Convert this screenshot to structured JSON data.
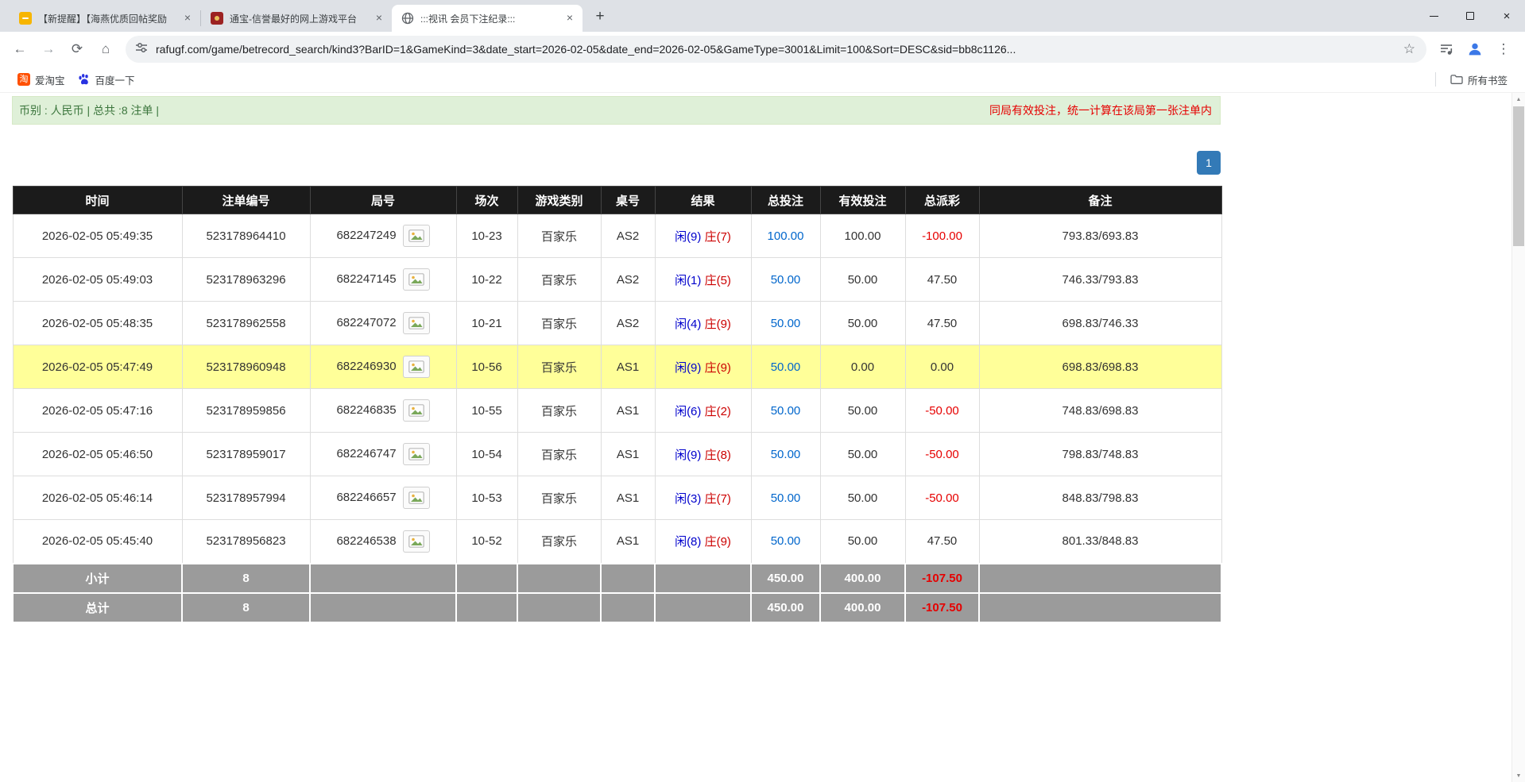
{
  "icons": {
    "tab_close": "×",
    "new_tab": "+",
    "window_close": "×",
    "back": "←",
    "forward": "→",
    "reload": "⟳",
    "home": "⌂",
    "star": "☆",
    "menu": "⋮",
    "scroll_up": "▲",
    "scroll_down": "▼",
    "taobao_glyph": "淘"
  },
  "colors": {
    "accent_blue": "#337ab7",
    "highlight_row": "#ffff99",
    "info_bar_bg": "#dff0d8",
    "info_text_green": "#3c763d",
    "notice_red": "#e60000",
    "link_blue": "#0066cc",
    "player_blue": "#0000cc",
    "banker_red": "#cc0000"
  },
  "browser": {
    "tabs": [
      {
        "title": "【新提醒】【海燕优质回帖奖励",
        "active": false
      },
      {
        "title": "通宝-信誉最好的网上游戏平台",
        "active": false
      },
      {
        "title": ":::视讯 会员下注纪录:::",
        "active": true
      }
    ],
    "url": "rafugf.com/game/betrecord_search/kind3?BarID=1&GameKind=3&date_start=2026-02-05&date_end=2026-02-05&GameType=3001&Limit=100&Sort=DESC&sid=bb8c1126...",
    "bookmarks": [
      {
        "label": "爱淘宝"
      },
      {
        "label": "百度一下"
      }
    ],
    "all_bookmarks_label": "所有书签"
  },
  "page": {
    "info_bar": {
      "summary": "币别 : 人民币 | 总共 :8 注单 |",
      "notice": "同局有效投注，统一计算在该局第一张注单内"
    },
    "pagination": {
      "current": "1"
    },
    "table": {
      "headers": [
        "时间",
        "注单编号",
        "局号",
        "场次",
        "游戏类别",
        "桌号",
        "结果",
        "总投注",
        "有效投注",
        "总派彩",
        "备注"
      ],
      "rows": [
        {
          "time": "2026-02-05 05:49:35",
          "bet_id": "523178964410",
          "round_no": "682247249",
          "session": "10-23",
          "game_type": "百家乐",
          "table_no": "AS2",
          "result_player": "闲(9)",
          "result_banker": "庄(7)",
          "total_bet": "100.00",
          "valid_bet": "100.00",
          "payout": "-100.00",
          "remark": "793.83/693.83",
          "highlight": false
        },
        {
          "time": "2026-02-05 05:49:03",
          "bet_id": "523178963296",
          "round_no": "682247145",
          "session": "10-22",
          "game_type": "百家乐",
          "table_no": "AS2",
          "result_player": "闲(1)",
          "result_banker": "庄(5)",
          "total_bet": "50.00",
          "valid_bet": "50.00",
          "payout": "47.50",
          "remark": "746.33/793.83",
          "highlight": false
        },
        {
          "time": "2026-02-05 05:48:35",
          "bet_id": "523178962558",
          "round_no": "682247072",
          "session": "10-21",
          "game_type": "百家乐",
          "table_no": "AS2",
          "result_player": "闲(4)",
          "result_banker": "庄(9)",
          "total_bet": "50.00",
          "valid_bet": "50.00",
          "payout": "47.50",
          "remark": "698.83/746.33",
          "highlight": false
        },
        {
          "time": "2026-02-05 05:47:49",
          "bet_id": "523178960948",
          "round_no": "682246930",
          "session": "10-56",
          "game_type": "百家乐",
          "table_no": "AS1",
          "result_player": "闲(9)",
          "result_banker": "庄(9)",
          "total_bet": "50.00",
          "valid_bet": "0.00",
          "payout": "0.00",
          "remark": "698.83/698.83",
          "highlight": true
        },
        {
          "time": "2026-02-05 05:47:16",
          "bet_id": "523178959856",
          "round_no": "682246835",
          "session": "10-55",
          "game_type": "百家乐",
          "table_no": "AS1",
          "result_player": "闲(6)",
          "result_banker": "庄(2)",
          "total_bet": "50.00",
          "valid_bet": "50.00",
          "payout": "-50.00",
          "remark": "748.83/698.83",
          "highlight": false
        },
        {
          "time": "2026-02-05 05:46:50",
          "bet_id": "523178959017",
          "round_no": "682246747",
          "session": "10-54",
          "game_type": "百家乐",
          "table_no": "AS1",
          "result_player": "闲(9)",
          "result_banker": "庄(8)",
          "total_bet": "50.00",
          "valid_bet": "50.00",
          "payout": "-50.00",
          "remark": "798.83/748.83",
          "highlight": false
        },
        {
          "time": "2026-02-05 05:46:14",
          "bet_id": "523178957994",
          "round_no": "682246657",
          "session": "10-53",
          "game_type": "百家乐",
          "table_no": "AS1",
          "result_player": "闲(3)",
          "result_banker": "庄(7)",
          "total_bet": "50.00",
          "valid_bet": "50.00",
          "payout": "-50.00",
          "remark": "848.83/798.83",
          "highlight": false
        },
        {
          "time": "2026-02-05 05:45:40",
          "bet_id": "523178956823",
          "round_no": "682246538",
          "session": "10-52",
          "game_type": "百家乐",
          "table_no": "AS1",
          "result_player": "闲(8)",
          "result_banker": "庄(9)",
          "total_bet": "50.00",
          "valid_bet": "50.00",
          "payout": "47.50",
          "remark": "801.33/848.83",
          "highlight": false
        }
      ],
      "subtotal": {
        "label": "小计",
        "count": "8",
        "total_bet": "450.00",
        "valid_bet": "400.00",
        "payout": "-107.50"
      },
      "grand_total": {
        "label": "总计",
        "count": "8",
        "total_bet": "450.00",
        "valid_bet": "400.00",
        "payout": "-107.50"
      }
    }
  }
}
